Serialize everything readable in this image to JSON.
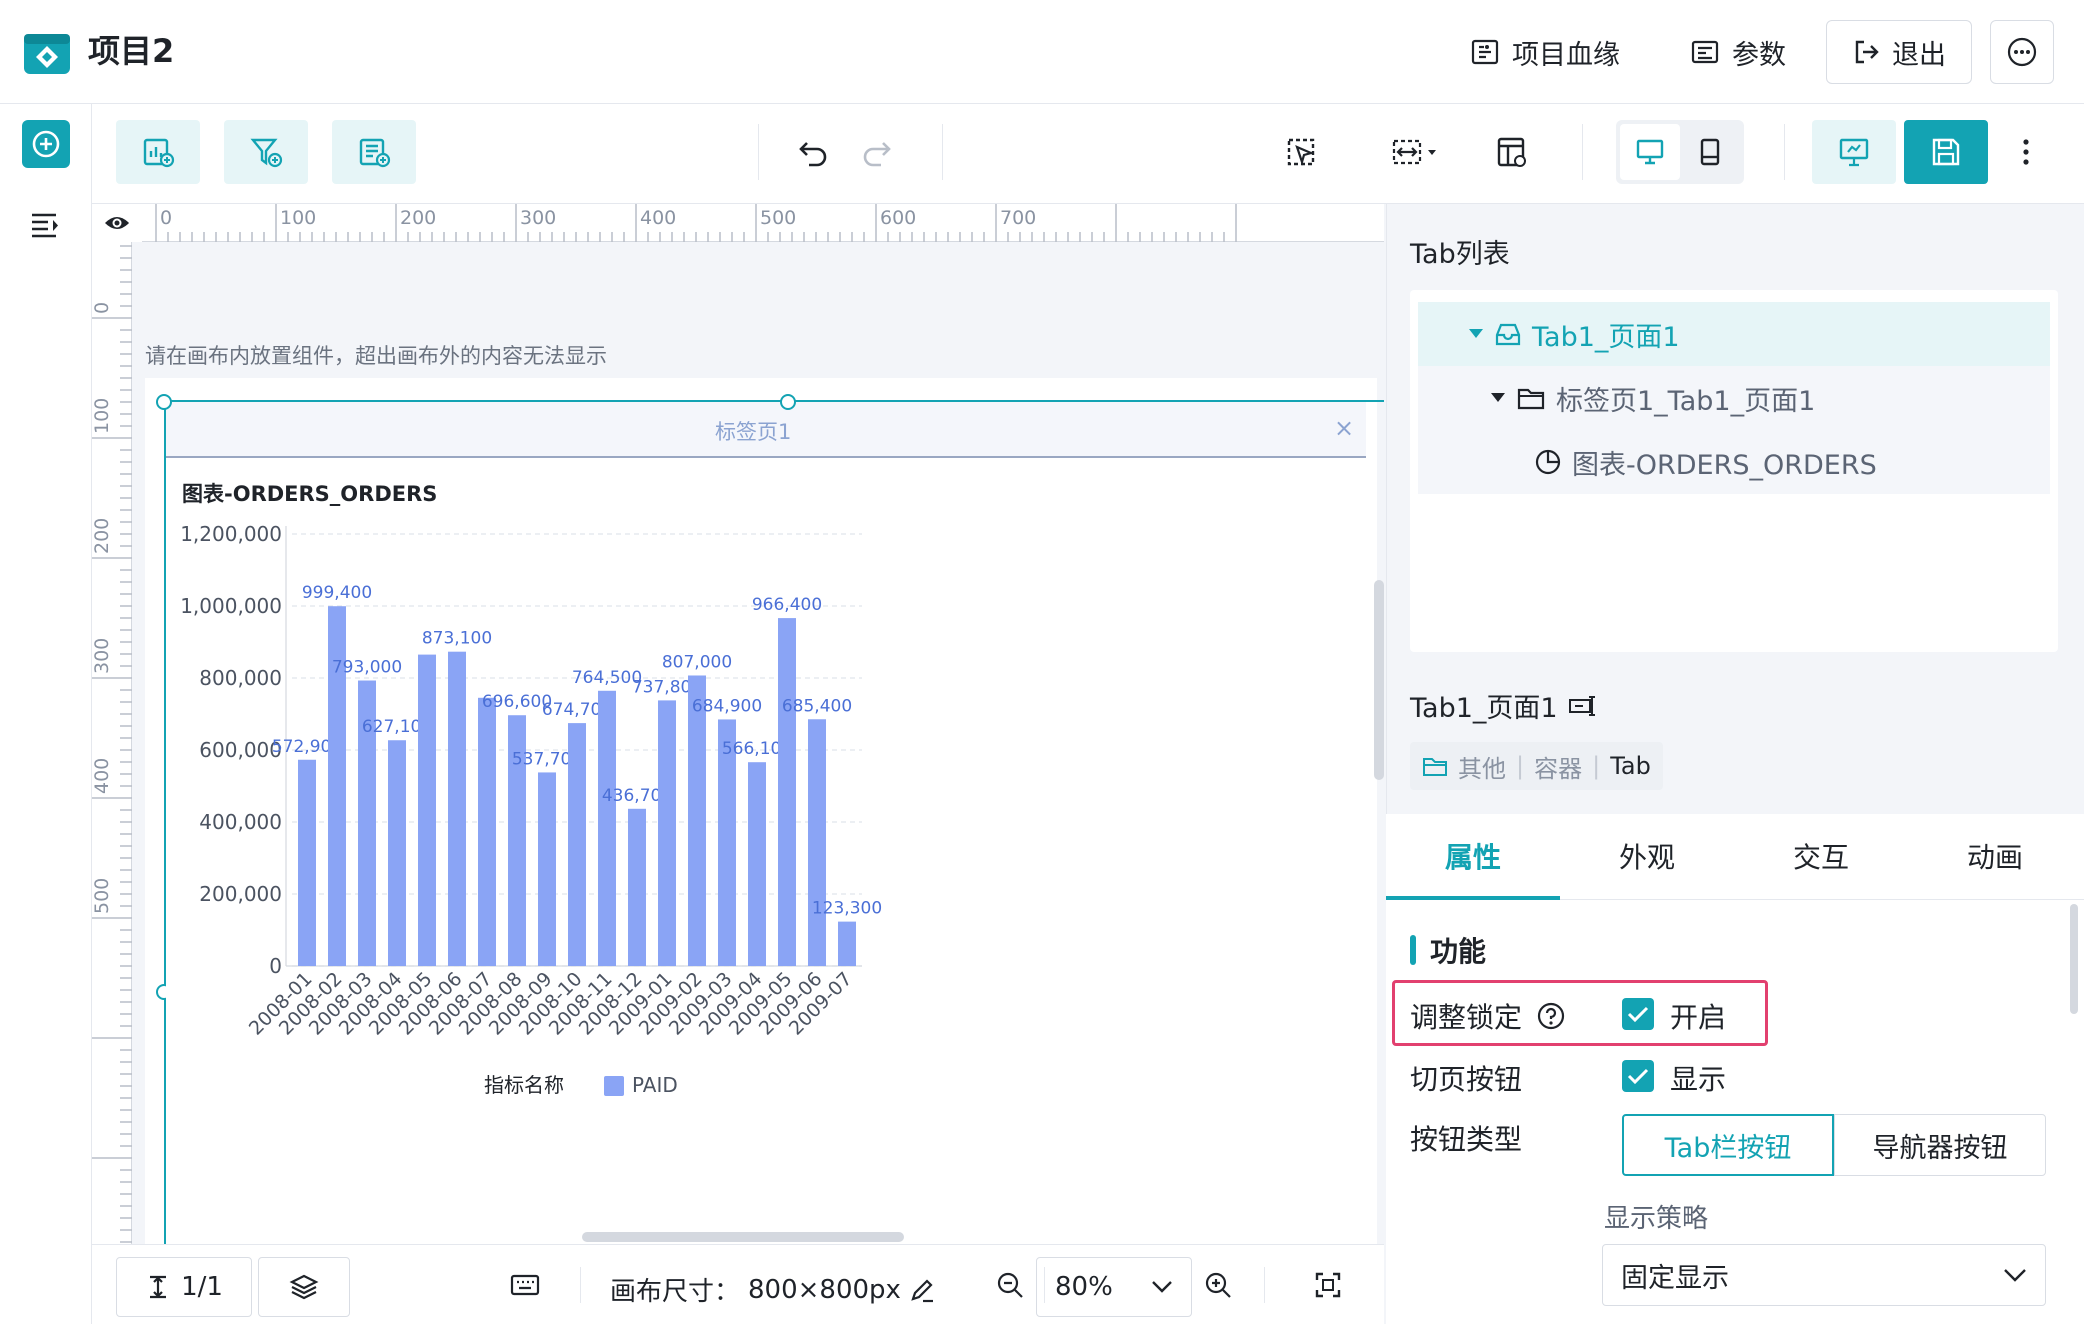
{
  "header": {
    "title": "项目2",
    "lineage_label": "项目血缘",
    "params_label": "参数",
    "exit_label": "退出",
    "icons": [
      "logo-icon",
      "lineage-icon",
      "params-icon",
      "exit-icon",
      "more-icon"
    ]
  },
  "canvas": {
    "hint": "请在画布内放置组件，超出画布外的内容无法显示",
    "ruler_h_ticks": [
      "0",
      "100",
      "200",
      "300",
      "400",
      "500",
      "600",
      "700"
    ],
    "ruler_v_ticks": [
      "0",
      "100",
      "200",
      "300",
      "400",
      "500"
    ],
    "tab_label": "标签页1",
    "close_glyph": "×"
  },
  "chart_data": {
    "type": "bar",
    "title": "图表-ORDERS_ORDERS",
    "categories": [
      "2008-01",
      "2008-02",
      "2008-03",
      "2008-04",
      "2008-05",
      "2008-06",
      "2008-07",
      "2008-08",
      "2008-09",
      "2008-10",
      "2008-11",
      "2008-12",
      "2009-01",
      "2009-02",
      "2009-03",
      "2009-04",
      "2009-05",
      "2009-06",
      "2009-07"
    ],
    "series": [
      {
        "name": "PAID",
        "values": [
          572900,
          999400,
          793000,
          627100,
          865000,
          873100,
          745000,
          696600,
          537700,
          674700,
          764500,
          436700,
          737800,
          807000,
          684900,
          566100,
          966400,
          685400,
          123300
        ]
      }
    ],
    "data_labels": {
      "0": "572,900",
      "1": "999,400",
      "2": "793,000",
      "3": "627,100",
      "5": "873,100",
      "7": "696,600",
      "8": "537,700",
      "9": "674,700",
      "10": "764,500",
      "11": "436,700",
      "12": "737,800",
      "13": "807,000",
      "14": "684,900",
      "15": "566,100",
      "16": "966,400",
      "17": "685,400",
      "18": "123,300"
    },
    "ylim": [
      0,
      1200000
    ],
    "yticks": [
      "0",
      "200,000",
      "400,000",
      "600,000",
      "800,000",
      "1,000,000",
      "1,200,000"
    ],
    "legend_title": "指标名称",
    "legend_position": "bottom-center",
    "grid": true,
    "colors": {
      "bar": "#8aa4f5",
      "label": "#4a6fd6"
    }
  },
  "statusbar": {
    "page_indicator": "1/1",
    "canvas_size_label": "画布尺寸：",
    "canvas_size_value": "800×800px",
    "zoom": "80%"
  },
  "rightpanel": {
    "tab_list_title": "Tab列表",
    "tree": [
      {
        "label": "Tab1_页面1",
        "level": 0,
        "selected": true
      },
      {
        "label": "标签页1_Tab1_页面1",
        "level": 1,
        "selected": false
      },
      {
        "label": "图表-ORDERS_ORDERS",
        "level": 2,
        "selected": false
      }
    ],
    "selected_name": "Tab1_页面1",
    "breadcrumb": [
      "其他",
      "容器",
      "Tab"
    ],
    "tabs": [
      "属性",
      "外观",
      "交互",
      "动画"
    ],
    "active_tab": "属性",
    "section": "功能",
    "props": {
      "resize_lock_label": "调整锁定",
      "resize_lock_value": "开启",
      "page_btn_label": "切页按钮",
      "page_btn_value": "显示",
      "btn_type_label": "按钮类型",
      "btn_type_options": [
        "Tab栏按钮",
        "导航器按钮"
      ],
      "display_strategy_label": "显示策略",
      "display_strategy_value": "固定显示"
    }
  },
  "colors": {
    "accent": "#13a3b3",
    "highlight": "#e2406f"
  }
}
